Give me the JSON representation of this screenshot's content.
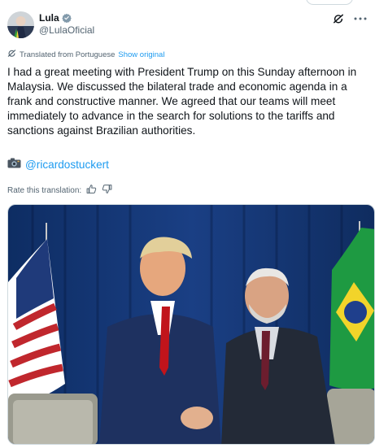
{
  "post": {
    "author": {
      "display_name": "Lula",
      "handle": "@LulaOficial",
      "verified_color": "#829aab"
    },
    "translation": {
      "notice": "Translated from Portuguese",
      "show_original": "Show original",
      "rate_label": "Rate this translation:"
    },
    "text": "I had a great meeting with President Trump on this Sunday afternoon in Malaysia. We discussed the bilateral trade and economic agenda in a frank and constructive manner. We agreed that our teams will meet immediately to advance in the search for solutions to the tariffs and sanctions against Brazilian authorities.",
    "photo_credit": {
      "icon": "camera-icon",
      "mention": "@ricardostuckert"
    },
    "icons": [
      "verified-icon",
      "grok-icon",
      "more-icon",
      "translate-icon",
      "thumbs-up-icon",
      "thumbs-down-icon",
      "camera-icon"
    ],
    "colors": {
      "link": "#1d9bf0",
      "secondary_text": "#536471",
      "primary_text": "#0f1419"
    }
  }
}
